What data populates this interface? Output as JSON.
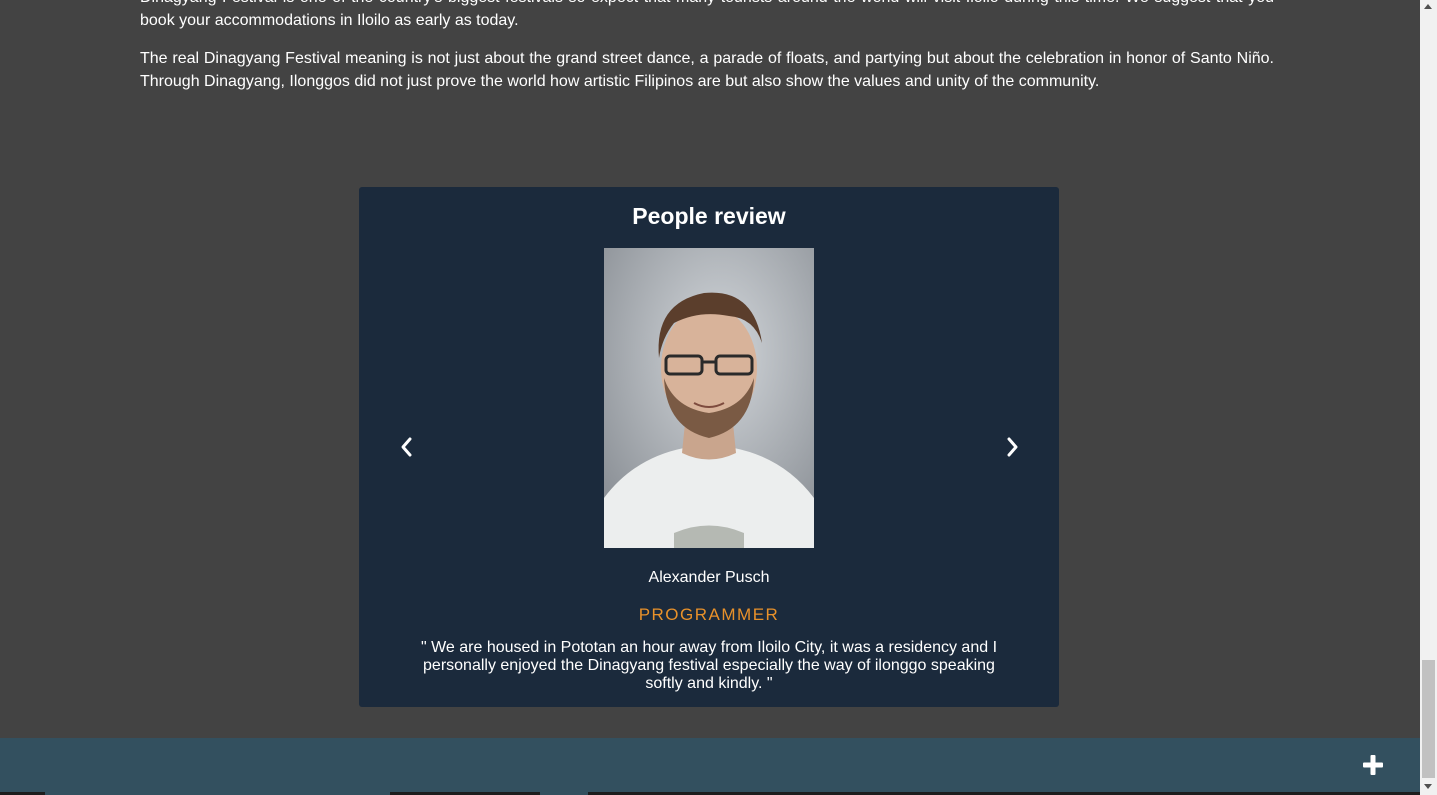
{
  "article": {
    "paragraph_1": "Dinagyang Festival is one of the country's biggest festivals so expect that many tourists around the world will visit Iloilo during this time. We suggest that you book your accommodations in Iloilo as early as today.",
    "paragraph_2": "The real Dinagyang Festival meaning is not just about the grand street dance, a parade of floats, and partying but about the celebration in honor of Santo Niño. Through Dinagyang, Ilonggos did not just prove the world how artistic Filipinos are but also show the values and unity of the community."
  },
  "review": {
    "title": "People review",
    "reviewer_name": "Alexander Pusch",
    "reviewer_role": "PROGRAMMER",
    "quote": "\" We are housed in Pototan an hour away from Iloilo City, it was a residency and I personally enjoyed the Dinagyang festival especially the way of ilonggo speaking softly and kindly. \"",
    "prev_icon": "chevron-left-icon",
    "next_icon": "chevron-right-icon"
  },
  "footer": {
    "action_icon": "plus-icon"
  },
  "colors": {
    "page_background": "#434343",
    "card_background": "#1b2a3c",
    "role_accent": "#e8912a",
    "footer_background": "#33505f"
  }
}
